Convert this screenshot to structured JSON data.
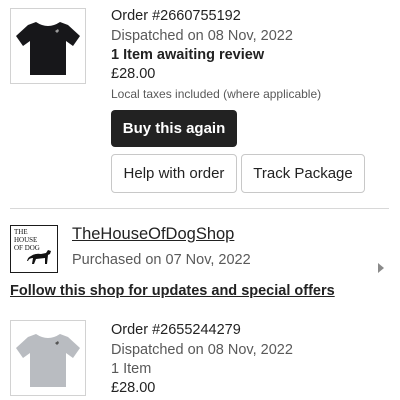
{
  "orders": [
    {
      "order_number": "Order #2660755192",
      "status": "Dispatched on 08 Nov, 2022",
      "review_status": "1 Item awaiting review",
      "price": "£28.00",
      "tax_note": "Local taxes included (where applicable)",
      "buy_again_label": "Buy this again",
      "help_label": "Help with order",
      "track_label": "Track Package",
      "tshirt_color": "#17171a"
    },
    {
      "order_number": "Order #2655244279",
      "status": "Dispatched on 08 Nov, 2022",
      "item_count": "1 Item",
      "price": "£28.00",
      "tshirt_color": "#b9bcc1"
    }
  ],
  "shop": {
    "name": "TheHouseOfDogShop",
    "purchased": "Purchased on 07 Nov, 2022",
    "follow_text": "Follow this shop for updates and special offers",
    "logo_line1": "THE",
    "logo_line2": "HOUSE",
    "logo_line3": "OF DOG"
  },
  "icons": {
    "shop_chevron": "chevron-right-icon"
  }
}
